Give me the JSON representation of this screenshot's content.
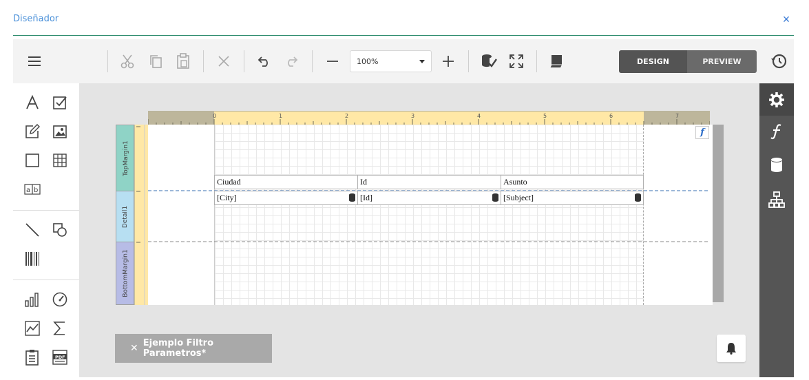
{
  "dialog": {
    "title": "Diseñador",
    "close_glyph": "×"
  },
  "toolbar": {
    "zoom_value": "100%",
    "mode_design": "DESIGN",
    "mode_preview": "PREVIEW",
    "icons": [
      "menu-icon",
      "cut-icon",
      "copy-icon",
      "paste-icon",
      "delete-icon",
      "undo-icon",
      "redo-icon",
      "zoom-out-icon",
      "zoom-in-icon",
      "validate-bindings-icon",
      "fullscreen-icon",
      "scripts-icon",
      "history-icon"
    ]
  },
  "ruler": {
    "numbers": [
      "0",
      "1",
      "2",
      "3",
      "4",
      "5",
      "6",
      "7"
    ]
  },
  "bands": {
    "top": "TopMargin1",
    "detail": "Detail1",
    "bottom": "BottomMargin1"
  },
  "table": {
    "headers": [
      "Ciudad",
      "Id",
      "Asunto"
    ],
    "fields": [
      "[City]",
      "[Id]",
      "[Subject]"
    ]
  },
  "fx_label": "f",
  "report_tab": {
    "close": "✕",
    "label": "Ejemplo Filtro Parametros*"
  },
  "colors": {
    "accent": "#4a90d9",
    "separator": "#2f8d6e",
    "panel": "#555555",
    "ruler": "#ffe8a6",
    "band_top": "#8fd3c6",
    "band_detail": "#b7dff2",
    "band_bottom": "#b7bce6"
  }
}
